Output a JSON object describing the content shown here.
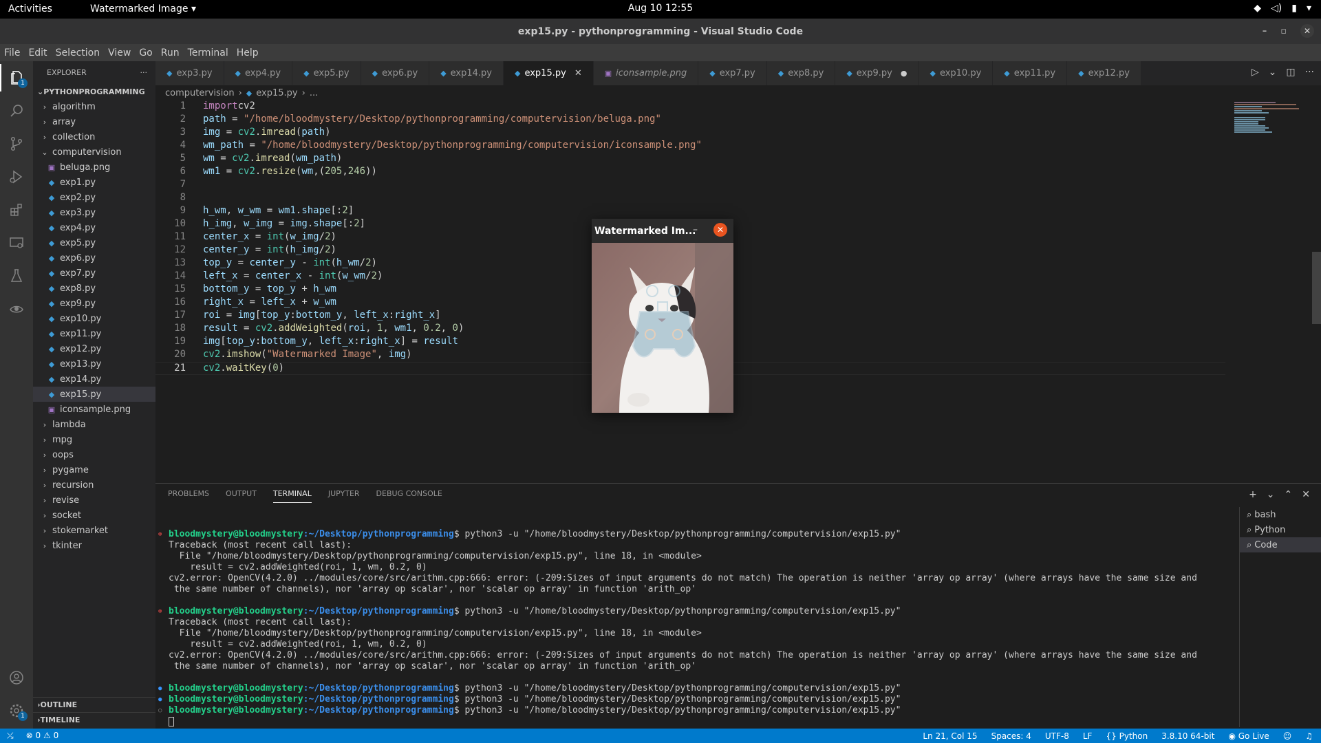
{
  "topbar": {
    "activities": "Activities",
    "app_menu": "Watermarked Image",
    "clock": "Aug 10  12:55"
  },
  "window": {
    "title": "exp15.py - pythonprogramming - Visual Studio Code"
  },
  "menubar": [
    "File",
    "Edit",
    "Selection",
    "View",
    "Go",
    "Run",
    "Terminal",
    "Help"
  ],
  "sidebar": {
    "header": "EXPLORER",
    "project": "PYTHONPROGRAMMING",
    "items": [
      {
        "label": "algorithm",
        "kind": "folder"
      },
      {
        "label": "array",
        "kind": "folder"
      },
      {
        "label": "collection",
        "kind": "folder"
      },
      {
        "label": "computervision",
        "kind": "folder-open"
      },
      {
        "label": "beluga.png",
        "kind": "image"
      },
      {
        "label": "exp1.py",
        "kind": "py"
      },
      {
        "label": "exp2.py",
        "kind": "py"
      },
      {
        "label": "exp3.py",
        "kind": "py"
      },
      {
        "label": "exp4.py",
        "kind": "py"
      },
      {
        "label": "exp5.py",
        "kind": "py"
      },
      {
        "label": "exp6.py",
        "kind": "py"
      },
      {
        "label": "exp7.py",
        "kind": "py"
      },
      {
        "label": "exp8.py",
        "kind": "py"
      },
      {
        "label": "exp9.py",
        "kind": "py"
      },
      {
        "label": "exp10.py",
        "kind": "py"
      },
      {
        "label": "exp11.py",
        "kind": "py"
      },
      {
        "label": "exp12.py",
        "kind": "py"
      },
      {
        "label": "exp13.py",
        "kind": "py"
      },
      {
        "label": "exp14.py",
        "kind": "py"
      },
      {
        "label": "exp15.py",
        "kind": "py",
        "selected": true
      },
      {
        "label": "iconsample.png",
        "kind": "image"
      },
      {
        "label": "lambda",
        "kind": "folder"
      },
      {
        "label": "mpg",
        "kind": "folder"
      },
      {
        "label": "oops",
        "kind": "folder"
      },
      {
        "label": "pygame",
        "kind": "folder"
      },
      {
        "label": "recursion",
        "kind": "folder"
      },
      {
        "label": "revise",
        "kind": "folder"
      },
      {
        "label": "socket",
        "kind": "folder"
      },
      {
        "label": "stokemarket",
        "kind": "folder"
      },
      {
        "label": "tkinter",
        "kind": "folder"
      }
    ],
    "outline": "OUTLINE",
    "timeline": "TIMELINE"
  },
  "tabs": [
    {
      "label": "exp3.py"
    },
    {
      "label": "exp4.py"
    },
    {
      "label": "exp5.py"
    },
    {
      "label": "exp6.py"
    },
    {
      "label": "exp14.py"
    },
    {
      "label": "exp15.py",
      "active": true
    },
    {
      "label": "iconsample.png",
      "image": true
    },
    {
      "label": "exp7.py"
    },
    {
      "label": "exp8.py"
    },
    {
      "label": "exp9.py",
      "modified": true
    },
    {
      "label": "exp10.py"
    },
    {
      "label": "exp11.py"
    },
    {
      "label": "exp12.py"
    }
  ],
  "breadcrumb": [
    "computervision",
    "exp15.py",
    "..."
  ],
  "editor": {
    "lines": [
      [
        [
          "kw",
          "import"
        ],
        [
          "",
          "cv2"
        ]
      ],
      [
        [
          "var",
          "path"
        ],
        [
          "",
          " = "
        ],
        [
          "str",
          "\"/home/bloodmystery/Desktop/pythonprogramming/computervision/beluga.png\""
        ]
      ],
      [
        [
          "var",
          "img"
        ],
        [
          "",
          " = "
        ],
        [
          "mod",
          "cv2"
        ],
        [
          "",
          "."
        ],
        [
          "fn",
          "imread"
        ],
        [
          "",
          "("
        ],
        [
          "var",
          "path"
        ],
        [
          "",
          ")"
        ]
      ],
      [
        [
          "var",
          "wm_path"
        ],
        [
          "",
          " = "
        ],
        [
          "str",
          "\"/home/bloodmystery/Desktop/pythonprogramming/computervision/iconsample.png\""
        ]
      ],
      [
        [
          "var",
          "wm"
        ],
        [
          "",
          " = "
        ],
        [
          "mod",
          "cv2"
        ],
        [
          "",
          "."
        ],
        [
          "fn",
          "imread"
        ],
        [
          "",
          "("
        ],
        [
          "var",
          "wm_path"
        ],
        [
          "",
          ")"
        ]
      ],
      [
        [
          "var",
          "wm1"
        ],
        [
          "",
          " = "
        ],
        [
          "mod",
          "cv2"
        ],
        [
          "",
          "."
        ],
        [
          "fn",
          "resize"
        ],
        [
          "",
          "("
        ],
        [
          "var",
          "wm"
        ],
        [
          "",
          ",("
        ],
        [
          "num",
          "205"
        ],
        [
          "",
          ","
        ],
        [
          "num",
          "246"
        ],
        [
          "",
          "))"
        ]
      ],
      [],
      [],
      [
        [
          "var",
          "h_wm"
        ],
        [
          "",
          ", "
        ],
        [
          "var",
          "w_wm"
        ],
        [
          "",
          " = "
        ],
        [
          "var",
          "wm1"
        ],
        [
          "",
          "."
        ],
        [
          "var",
          "shape"
        ],
        [
          "",
          "[:"
        ],
        [
          "num",
          "2"
        ],
        [
          "",
          "]"
        ]
      ],
      [
        [
          "var",
          "h_img"
        ],
        [
          "",
          ", "
        ],
        [
          "var",
          "w_img"
        ],
        [
          "",
          " = "
        ],
        [
          "var",
          "img"
        ],
        [
          "",
          "."
        ],
        [
          "var",
          "shape"
        ],
        [
          "",
          "[:"
        ],
        [
          "num",
          "2"
        ],
        [
          "",
          "]"
        ]
      ],
      [
        [
          "var",
          "center_x"
        ],
        [
          "",
          " = "
        ],
        [
          "bi",
          "int"
        ],
        [
          "",
          "("
        ],
        [
          "var",
          "w_img"
        ],
        [
          "",
          "/"
        ],
        [
          "num",
          "2"
        ],
        [
          "",
          ")"
        ]
      ],
      [
        [
          "var",
          "center_y"
        ],
        [
          "",
          " = "
        ],
        [
          "bi",
          "int"
        ],
        [
          "",
          "("
        ],
        [
          "var",
          "h_img"
        ],
        [
          "",
          "/"
        ],
        [
          "num",
          "2"
        ],
        [
          "",
          ")"
        ]
      ],
      [
        [
          "var",
          "top_y"
        ],
        [
          "",
          " = "
        ],
        [
          "var",
          "center_y"
        ],
        [
          "",
          " - "
        ],
        [
          "bi",
          "int"
        ],
        [
          "",
          "("
        ],
        [
          "var",
          "h_wm"
        ],
        [
          "",
          "/"
        ],
        [
          "num",
          "2"
        ],
        [
          "",
          ")"
        ]
      ],
      [
        [
          "var",
          "left_x"
        ],
        [
          "",
          " = "
        ],
        [
          "var",
          "center_x"
        ],
        [
          "",
          " - "
        ],
        [
          "bi",
          "int"
        ],
        [
          "",
          "("
        ],
        [
          "var",
          "w_wm"
        ],
        [
          "",
          "/"
        ],
        [
          "num",
          "2"
        ],
        [
          "",
          ")"
        ]
      ],
      [
        [
          "var",
          "bottom_y"
        ],
        [
          "",
          " = "
        ],
        [
          "var",
          "top_y"
        ],
        [
          "",
          " + "
        ],
        [
          "var",
          "h_wm"
        ]
      ],
      [
        [
          "var",
          "right_x"
        ],
        [
          "",
          " = "
        ],
        [
          "var",
          "left_x"
        ],
        [
          "",
          " + "
        ],
        [
          "var",
          "w_wm"
        ]
      ],
      [
        [
          "var",
          "roi"
        ],
        [
          "",
          " = "
        ],
        [
          "var",
          "img"
        ],
        [
          "",
          "["
        ],
        [
          "var",
          "top_y"
        ],
        [
          "",
          ":"
        ],
        [
          "var",
          "bottom_y"
        ],
        [
          "",
          ", "
        ],
        [
          "var",
          "left_x"
        ],
        [
          "",
          ":"
        ],
        [
          "var",
          "right_x"
        ],
        [
          "",
          "]"
        ]
      ],
      [
        [
          "var",
          "result"
        ],
        [
          "",
          " = "
        ],
        [
          "mod",
          "cv2"
        ],
        [
          "",
          "."
        ],
        [
          "fn",
          "addWeighted"
        ],
        [
          "",
          "("
        ],
        [
          "var",
          "roi"
        ],
        [
          "",
          ", "
        ],
        [
          "num",
          "1"
        ],
        [
          "",
          ", "
        ],
        [
          "var",
          "wm1"
        ],
        [
          "",
          ", "
        ],
        [
          "num",
          "0.2"
        ],
        [
          "",
          ", "
        ],
        [
          "num",
          "0"
        ],
        [
          "",
          ")"
        ]
      ],
      [
        [
          "var",
          "img"
        ],
        [
          "",
          "["
        ],
        [
          "var",
          "top_y"
        ],
        [
          "",
          ":"
        ],
        [
          "var",
          "bottom_y"
        ],
        [
          "",
          ", "
        ],
        [
          "var",
          "left_x"
        ],
        [
          "",
          ":"
        ],
        [
          "var",
          "right_x"
        ],
        [
          "",
          "] = "
        ],
        [
          "var",
          "result"
        ]
      ],
      [
        [
          "mod",
          "cv2"
        ],
        [
          "",
          "."
        ],
        [
          "fn",
          "imshow"
        ],
        [
          "",
          "("
        ],
        [
          "str",
          "\"Watermarked Image\""
        ],
        [
          "",
          ", "
        ],
        [
          "var",
          "img"
        ],
        [
          "",
          ")"
        ]
      ],
      [
        [
          "mod",
          "cv2"
        ],
        [
          "",
          "."
        ],
        [
          "fn",
          "waitKey"
        ],
        [
          "",
          "("
        ],
        [
          "num",
          "0"
        ],
        [
          "",
          ")"
        ]
      ]
    ],
    "current_line": 21
  },
  "image_window": {
    "title": "Watermarked Im...",
    "minimize": "–",
    "close": "✕"
  },
  "panel": {
    "tabs": [
      "PROBLEMS",
      "OUTPUT",
      "TERMINAL",
      "JUPYTER",
      "DEBUG CONSOLE"
    ],
    "active_tab": "TERMINAL",
    "prompt_user": "bloodmystery@bloodmystery",
    "prompt_path": ":~/Desktop/pythonprogramming",
    "command": "$ python3 -u \"/home/bloodmystery/Desktop/pythonprogramming/computervision/exp15.py\"",
    "traceback": [
      "Traceback (most recent call last):",
      "  File \"/home/bloodmystery/Desktop/pythonprogramming/computervision/exp15.py\", line 18, in <module>",
      "    result = cv2.addWeighted(roi, 1, wm, 0.2, 0)",
      "cv2.error: OpenCV(4.2.0) ../modules/core/src/arithm.cpp:666: error: (-209:Sizes of input arguments do not match) The operation is neither 'array op array' (where arrays have the same size and",
      " the same number of channels), nor 'array op scalar', nor 'scalar op array' in function 'arith_op'"
    ],
    "terminals": [
      "bash",
      "Python",
      "Code"
    ],
    "selected_terminal": "Code"
  },
  "statusbar": {
    "errors": "0",
    "warnings": "0",
    "position": "Ln 21, Col 15",
    "spaces": "Spaces: 4",
    "encoding": "UTF-8",
    "eol": "LF",
    "language": "Python",
    "interpreter": "3.8.10 64-bit",
    "golive": "Go Live"
  },
  "badges": {
    "explorer": "1",
    "settings": "1"
  }
}
